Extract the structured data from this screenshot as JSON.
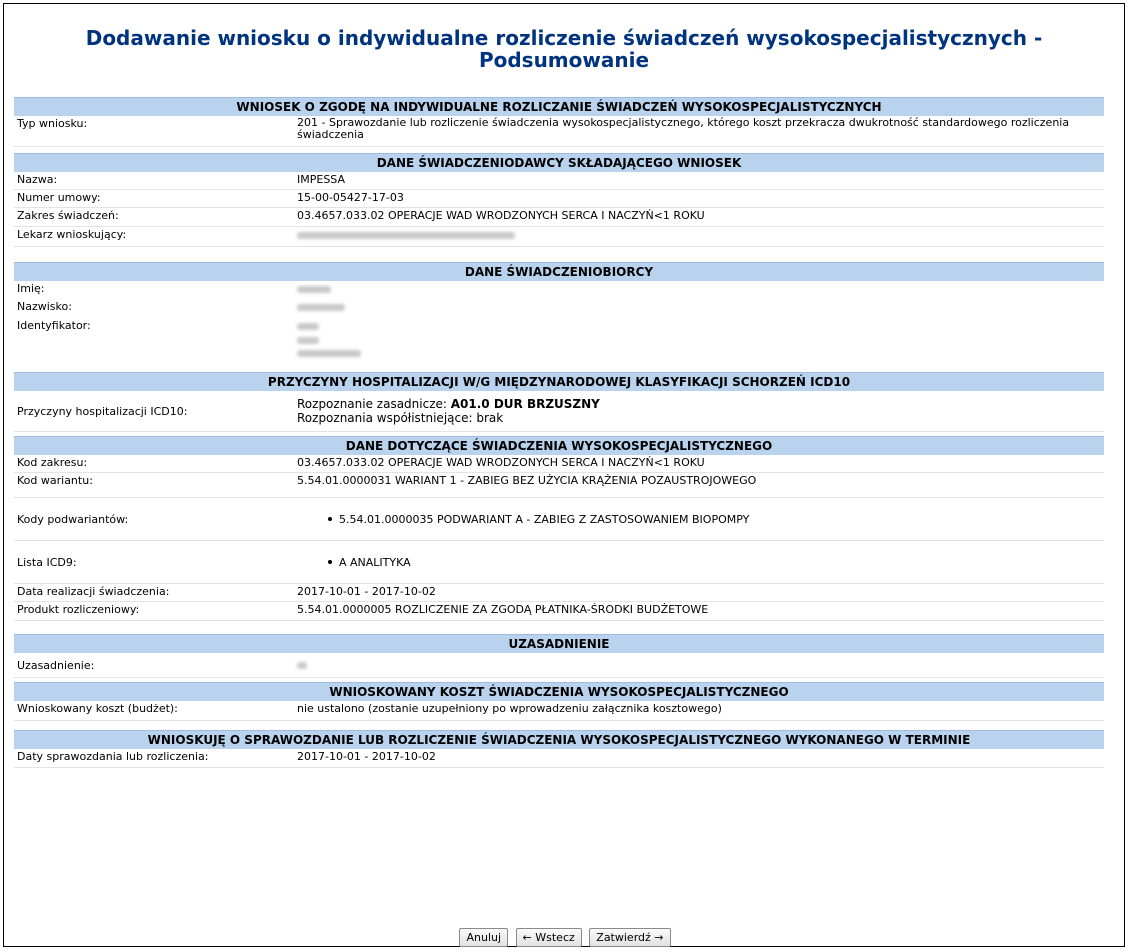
{
  "page": {
    "title_line1": "Dodawanie wniosku o indywidualne rozliczenie świadczeń wysokospecjalistycznych -",
    "title_line2": "Podsumowanie"
  },
  "sections": {
    "wniosek": {
      "header": "WNIOSEK O ZGODĘ NA INDYWIDUALNE ROZLICZANIE ŚWIADCZEŃ WYSOKOSPECJALISTYCZNYCH",
      "typ_label": "Typ wniosku:",
      "typ_value": "201 - Sprawozdanie lub rozliczenie świadczenia wysokospecjalistycznego, którego koszt przekracza dwukrotność standardowego rozliczenia świadczenia"
    },
    "dawca": {
      "header": "DANE ŚWIADCZENIODAWCY SKŁADAJĄCEGO WNIOSEK",
      "nazwa_label": "Nazwa:",
      "nazwa_value": "IMPESSA",
      "umowa_label": "Numer umowy:",
      "umowa_value": "15-00-05427-17-03",
      "zakres_label": "Zakres świadczeń:",
      "zakres_value": "03.4657.033.02 OPERACJE WAD WRODZONYCH SERCA I NACZYŃ<1 ROKU",
      "lekarz_label": "Lekarz wnioskujący:"
    },
    "biorca": {
      "header": "DANE ŚWIADCZENIOBIORCY",
      "imie_label": "Imię:",
      "nazwisko_label": "Nazwisko:",
      "identyfikator_label": "Identyfikator:"
    },
    "przyczyny": {
      "header": "PRZYCZYNY HOSPITALIZACJI W/G MIĘDZYNARODOWEJ KLASYFIKACJI SCHORZEŃ ICD10",
      "label": "Przyczyny hospitalizacji ICD10:",
      "zasadnicze_prefix": "Rozpoznanie zasadnicze: ",
      "zasadnicze_value": "A01.0 DUR BRZUSZNY",
      "wspol": "Rozpoznania współistniejące: brak"
    },
    "swiadczenie": {
      "header": "DANE DOTYCZĄCE ŚWIADCZENIA WYSOKOSPECJALISTYCZNEGO",
      "kod_zakresu_label": "Kod zakresu:",
      "kod_zakresu_value": "03.4657.033.02 OPERACJE WAD WRODZONYCH SERCA I NACZYŃ<1 ROKU",
      "kod_wariantu_label": "Kod wariantu:",
      "kod_wariantu_value": "5.54.01.0000031 WARIANT 1 - ZABIEG BEZ UŻYCIA KRĄŻENIA POZAUSTROJOWEGO",
      "podwarianty_label": "Kody podwariantów:",
      "podwarianty_value": "5.54.01.0000035 PODWARIANT A - ZABIEG Z ZASTOSOWANIEM BIOPOMPY",
      "icd9_label": "Lista ICD9:",
      "icd9_value": "A ANALITYKA",
      "data_label": "Data realizacji świadczenia:",
      "data_value": "2017-10-01 - 2017-10-02",
      "produkt_label": "Produkt rozliczeniowy:",
      "produkt_value": "5.54.01.0000005 ROZLICZENIE ZA ZGODĄ PŁATNIKA-ŚRODKI BUDŻETOWE"
    },
    "uzasadnienie": {
      "header": "UZASADNIENIE",
      "label": "Uzasadnienie:"
    },
    "koszt": {
      "header": "WNIOSKOWANY KOSZT ŚWIADCZENIA WYSOKOSPECJALISTYCZNEGO",
      "label": "Wnioskowany koszt (budżet):",
      "value": "nie ustalono (zostanie uzupełniony po wprowadzeniu załącznika kosztowego)"
    },
    "termin": {
      "header": "WNIOSKUJĘ O SPRAWOZDANIE LUB ROZLICZENIE ŚWIADCZENIA WYSOKOSPECJALISTYCZNEGO WYKONANEGO W TERMINIE",
      "label": "Daty sprawozdania lub rozliczenia:",
      "value": "2017-10-01 - 2017-10-02"
    }
  },
  "buttons": {
    "cancel": "Anuluj",
    "back": "← Wstecz",
    "confirm": "Zatwierdź →"
  }
}
